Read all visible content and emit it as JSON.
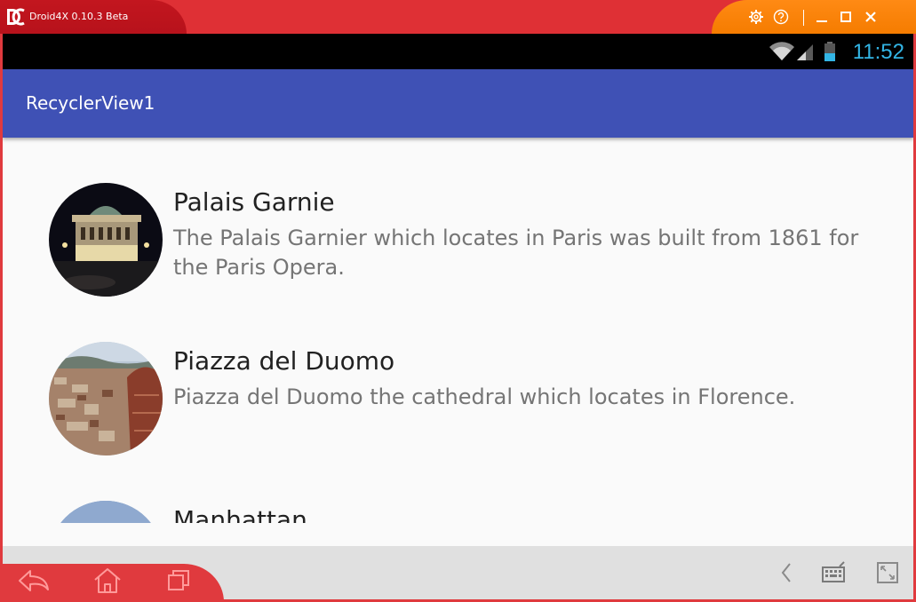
{
  "window": {
    "app_name": "Droid4X 0.10.3 Beta",
    "controls": {
      "settings_icon": "gear-icon",
      "help_icon": "help-icon",
      "minimize": "minimize-icon",
      "maximize": "maximize-icon",
      "close": "close-icon"
    },
    "colors": {
      "title_red": "#df3035",
      "accent_orange": "#f57c00"
    }
  },
  "statusbar": {
    "time": "11:52",
    "wifi_icon": "wifi-icon",
    "signal_icon": "signal-icon",
    "battery_icon": "battery-icon",
    "clock_color": "#33b5e5"
  },
  "appbar": {
    "title": "RecyclerView1",
    "color": "#3f51b5"
  },
  "list": {
    "items": [
      {
        "title": "Palais Garnie",
        "description": "The Palais Garnier which locates in Paris was built from 1861 for the Paris Opera."
      },
      {
        "title": "Piazza del Duomo",
        "description": "Piazza del Duomo the cathedral which locates in Florence."
      },
      {
        "title": "Manhattan",
        "description": ""
      }
    ]
  },
  "navbar": {
    "back": "back-icon",
    "home": "home-icon",
    "recents": "recents-icon",
    "collapse": "chevron-left-icon",
    "keyboard": "keyboard-icon",
    "fullscreen": "fullscreen-icon"
  }
}
